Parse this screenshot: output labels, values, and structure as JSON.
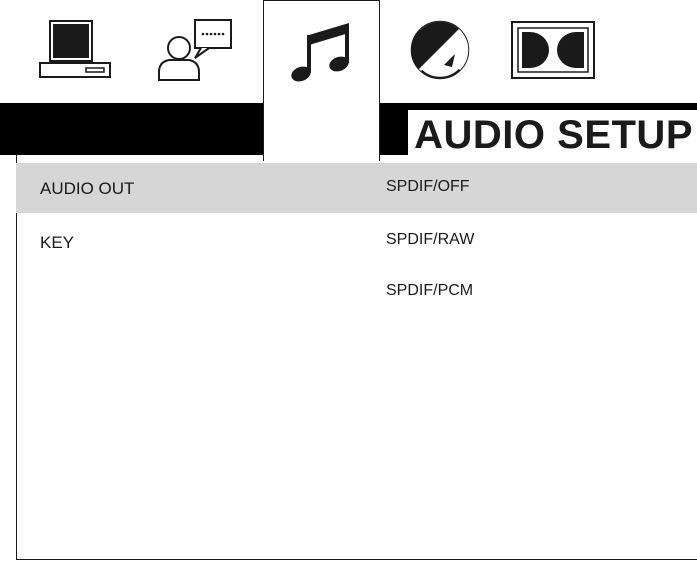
{
  "tabs": [
    {
      "icon": "monitor-icon",
      "active": false
    },
    {
      "icon": "language-speech-icon",
      "active": false
    },
    {
      "icon": "music-note-icon",
      "active": true
    },
    {
      "icon": "video-adjust-icon",
      "active": false
    },
    {
      "icon": "dolby-icon",
      "active": false
    }
  ],
  "page_title": "AUDIO SETUP",
  "menu": {
    "items": [
      {
        "label": "AUDIO OUT",
        "selected": true
      },
      {
        "label": "KEY",
        "selected": false
      }
    ],
    "options": [
      {
        "label": "SPDIF/OFF",
        "selected": true
      },
      {
        "label": "SPDIF/RAW",
        "selected": false
      },
      {
        "label": "SPDIF/PCM",
        "selected": false
      }
    ]
  },
  "colors": {
    "title_bar": "#000000",
    "highlight": "#d6d6d6",
    "text": "#1a1a1a"
  }
}
